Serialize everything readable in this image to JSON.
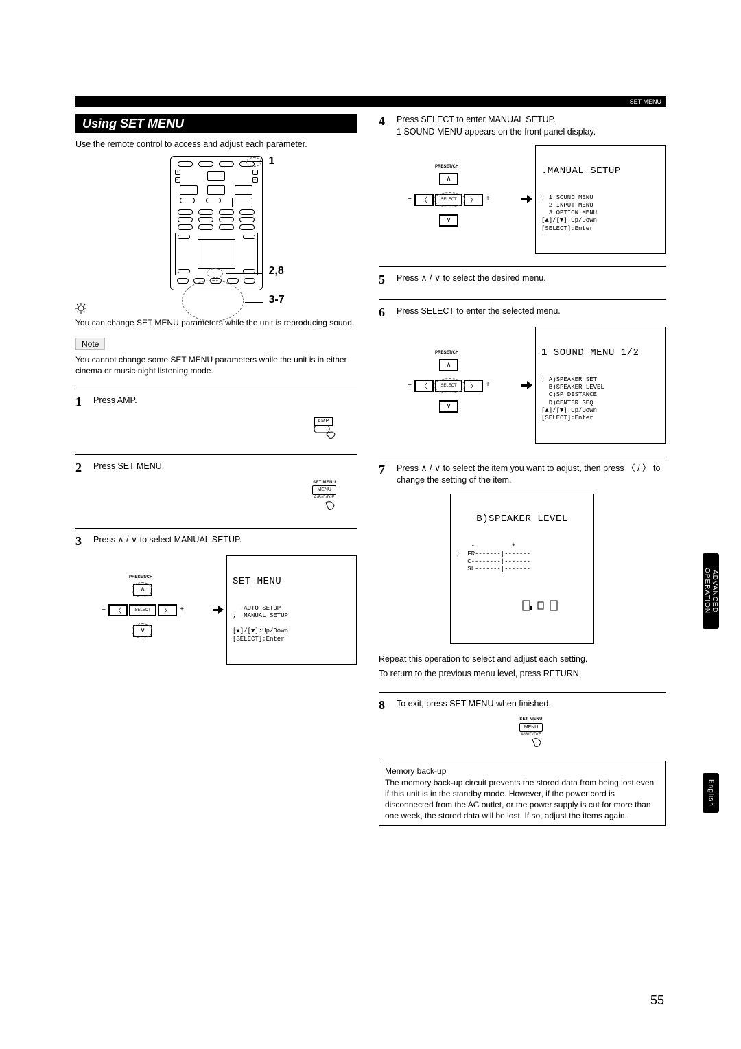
{
  "header": {
    "section": "SET MENU"
  },
  "title": "Using SET MENU",
  "intro": "Use the remote control to access and adjust each parameter.",
  "callouts": {
    "top": "1",
    "mid": "2,8",
    "bottom": "3-7"
  },
  "tip": "You can change SET MENU parameters while the unit is reproducing sound.",
  "note_label": "Note",
  "note_text": "You cannot change some SET MENU parameters while the unit is in either cinema or music night listening mode.",
  "steps": {
    "s1": {
      "num": "1",
      "text": "Press AMP.",
      "btn": "AMP"
    },
    "s2": {
      "num": "2",
      "text": "Press SET MENU.",
      "toplabel": "SET MENU",
      "btn": "MENU",
      "sub": "A/B/C/D/E"
    },
    "s3": {
      "num": "3",
      "text": "Press  ∧ / ∨  to select MANUAL SETUP.",
      "osd_title": "SET MENU",
      "osd_body": "  .AUTO SETUP\n; .MANUAL SETUP\n\n[▲]/[▼]:Up/Down\n[SELECT]:Enter",
      "pad_label": "PRESET/CH",
      "pad_select": "SELECT"
    },
    "s4": {
      "num": "4",
      "line1": "Press SELECT to enter MANUAL SETUP.",
      "line2": "1 SOUND MENU appears on the front panel display.",
      "osd_title": ".MANUAL SETUP",
      "osd_body": "; 1 SOUND MENU\n  2 INPUT MENU\n  3 OPTION MENU\n[▲]/[▼]:Up/Down\n[SELECT]:Enter",
      "pad_label": "PRESET/CH",
      "pad_select": "SELECT"
    },
    "s5": {
      "num": "5",
      "text": "Press  ∧ / ∨  to select the desired menu."
    },
    "s6": {
      "num": "6",
      "text": "Press SELECT to enter the selected menu.",
      "osd_title": "1 SOUND MENU 1/2",
      "osd_body": "; A)SPEAKER SET\n  B)SPEAKER LEVEL\n  C)SP DISTANCE\n  D)CENTER GEQ\n[▲]/[▼]:Up/Down\n[SELECT]:Enter",
      "pad_label": "PRESET/CH",
      "pad_select": "SELECT"
    },
    "s7": {
      "num": "7",
      "text": "Press  ∧ / ∨  to select the item you want to adjust, then press  〈 / 〉 to change the setting of the item.",
      "osd_title": "B)SPEAKER LEVEL",
      "osd_body": "    -          +\n;  FR-------|-------\n   C--------|-------\n   SL-------|-------",
      "after1": "Repeat this operation to select and adjust each setting.",
      "after2": "To return to the previous menu level, press RETURN."
    },
    "s8": {
      "num": "8",
      "text": "To exit, press SET MENU when finished.",
      "toplabel": "SET MENU",
      "btn": "MENU",
      "sub": "A/B/C/D/E"
    }
  },
  "memo": {
    "title": "Memory back-up",
    "body": "The memory back-up circuit prevents the stored data from being lost even if this unit is in the standby mode. However, if the power cord is disconnected from the AC outlet, or the power supply is cut for more than one week, the stored data will be lost. If so, adjust the items again."
  },
  "side_tab": "ADVANCED\nOPERATION",
  "lang_tab": "English",
  "page": "55"
}
